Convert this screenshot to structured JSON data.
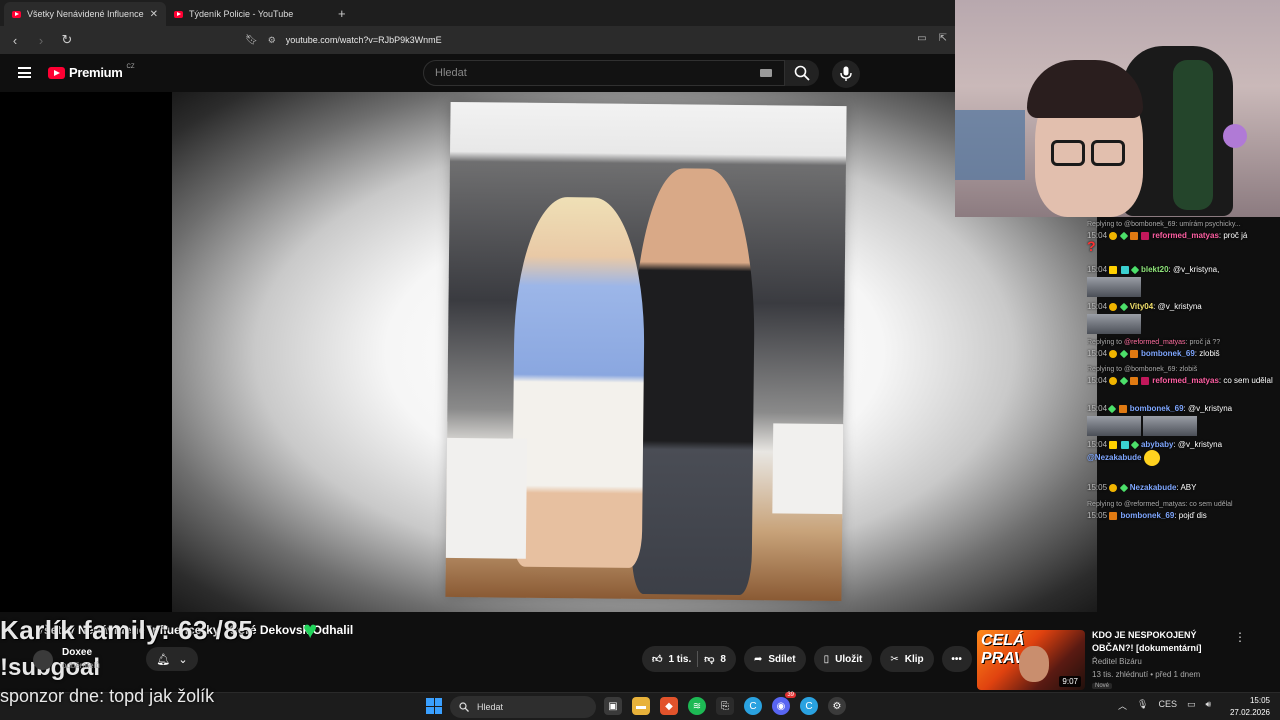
{
  "browser": {
    "tabs": [
      {
        "label": "Všetky Nenávidené Influencerky",
        "active": true
      },
      {
        "label": "Týdeník Policie - YouTube",
        "active": false
      }
    ],
    "url": "youtube.com/watch?v=RJbP9k3WnmE"
  },
  "youtube": {
    "brand": "Premium",
    "region": "CZ",
    "search_placeholder": "Hledat"
  },
  "video": {
    "title": "Všetky Nenávidené Influencerky, Ktoré Dekovsk Odhalil",
    "channel": "Doxee",
    "subscribers": "odběratelů",
    "likes": "1 tis.",
    "dislikes": "8",
    "share": "Sdílet",
    "save": "Uložit",
    "clip": "Klip"
  },
  "stream_overlay": {
    "goal": "Karlík family: 63 /85",
    "subgoal": "!subgoal",
    "sponsor": "sponzor dne: topd jak žolík"
  },
  "recommendation": {
    "thumb_text": "CELÁ PRAVDA",
    "duration": "9:07",
    "title": "KDO JE NESPOKOJENÝ OBČAN?! [dokumentární]",
    "channel": "Ředitel Bizáru",
    "meta": "13 tis. zhlédnutí • před 1 dnem",
    "badge": "Nové"
  },
  "chat": {
    "messages": [
      {
        "reply": "Replying to @bombonek_69: umírám psychicky...",
        "time": "15:04",
        "user": "reformed_matyas",
        "text": "proč já"
      },
      {
        "time": "15:04",
        "user": "blekt20",
        "text": "@v_kristyna,"
      },
      {
        "time": "15:04",
        "user": "Vity04",
        "text": "@v_kristyna"
      },
      {
        "reply_prefix": "Replying to",
        "reply_user": "@reformed_matyas",
        "reply_text": "proč já ??",
        "time": "15:04",
        "user": "bombonek_69",
        "text": "zlobiš"
      },
      {
        "reply": "Replying to @bombonek_69: zlobiš",
        "time": "15:04",
        "user": "reformed_matyas",
        "text": "co sem udělal"
      },
      {
        "time": "15:04",
        "user": "bombonek_69",
        "text": "@v_kristyna"
      },
      {
        "time": "15:04",
        "user": "abybaby",
        "text": "@v_kristyna",
        "mention": "@Nezakabude"
      },
      {
        "time": "15:05",
        "user": "Nezakabude",
        "text": "ABY"
      },
      {
        "reply": "Replying to @reformed_matyas: co sem udělal",
        "time": "15:05",
        "user": "bombonek_69",
        "text": "pojď dis"
      }
    ]
  },
  "taskbar": {
    "search_label": "Hledat",
    "lang": "CES",
    "time": "15:05",
    "date": "27.02.2026",
    "discord_badge": "39"
  }
}
